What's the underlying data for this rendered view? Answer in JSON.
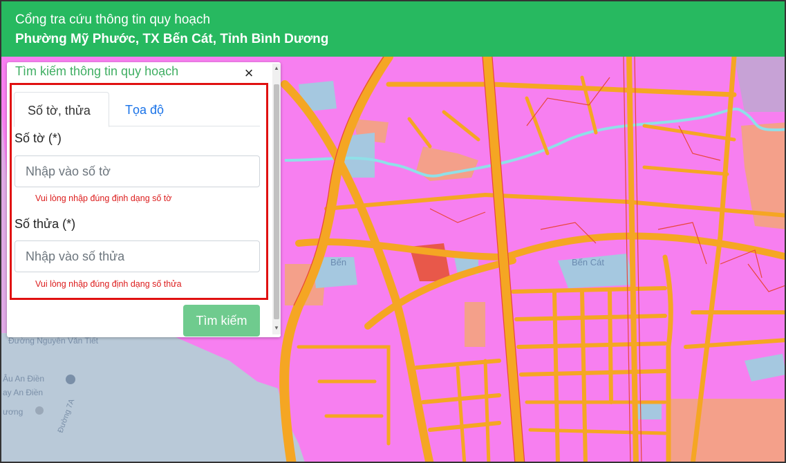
{
  "header": {
    "title": "Cổng tra cứu thông tin quy hoạch",
    "subtitle": "Phường Mỹ Phước, TX Bến Cát, Tỉnh Bình Dương"
  },
  "panel": {
    "title": "Tìm kiếm thông tin quy hoạch",
    "close_symbol": "×",
    "tabs": [
      {
        "label": "Số tờ, thửa",
        "active": true
      },
      {
        "label": "Tọa độ",
        "active": false
      }
    ],
    "sheet_label": "Số tờ (*)",
    "sheet_placeholder": "Nhập vào số tờ",
    "sheet_error": "Vui lòng nhập đúng định dạng số tờ",
    "parcel_label": "Số thửa (*)",
    "parcel_placeholder": "Nhập vào số thửa",
    "parcel_error": "Vui lòng nhập đúng định dạng số thửa",
    "search_button": "Tìm kiếm"
  },
  "map": {
    "labels": [
      "Bến",
      "Bến Cát",
      "Đường Nguyễn Văn Tiết",
      "Âu An Điền",
      "ay An Điền",
      "ương",
      "Đường 7A"
    ],
    "colors": {
      "residential": "#f77ff0",
      "road": "#f5a623",
      "road_edge": "#e8463a",
      "water": "#8fd8e8",
      "public": "#a5c8e0",
      "commercial": "#f4a08a"
    }
  },
  "colors": {
    "header_bg": "#27b960",
    "accent_green": "#3fae62",
    "link_blue": "#1a73e8",
    "error_red": "#dc1c1c",
    "highlight_red": "#e01010",
    "button_green": "#6fcb8e"
  }
}
